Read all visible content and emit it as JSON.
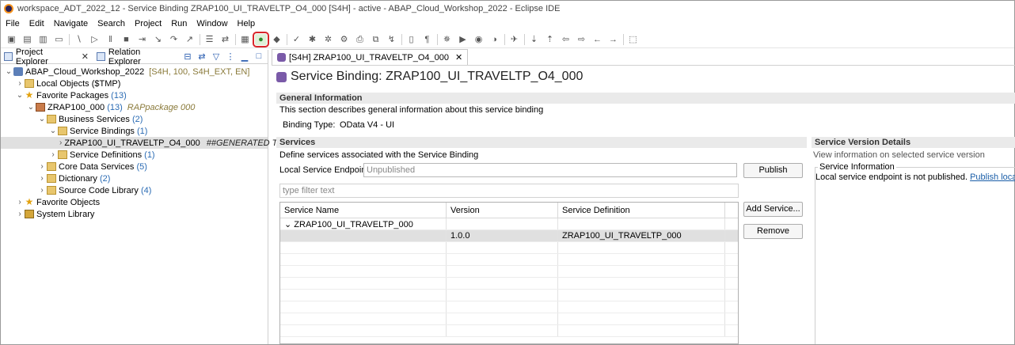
{
  "window": {
    "title": "workspace_ADT_2022_12 - Service Binding ZRAP100_UI_TRAVELTP_O4_000 [S4H]  - active - ABAP_Cloud_Workshop_2022 - Eclipse IDE"
  },
  "menu": [
    "File",
    "Edit",
    "Navigate",
    "Search",
    "Project",
    "Run",
    "Window",
    "Help"
  ],
  "left_panel": {
    "tabs": [
      {
        "label": "Project Explorer"
      },
      {
        "label": "Relation Explorer"
      }
    ],
    "tree": [
      {
        "label": "ABAP_Cloud_Workshop_2022",
        "extra": "[S4H, 100, S4H_EXT, EN]"
      },
      {
        "label": "Local Objects ($TMP)"
      },
      {
        "label": "Favorite Packages",
        "count": "(13)"
      },
      {
        "label": "ZRAP100_000",
        "count": "(13)",
        "extra": "RAPpackage 000"
      },
      {
        "label": "Business Services",
        "count": "(2)"
      },
      {
        "label": "Service Bindings",
        "count": "(1)"
      },
      {
        "label": "ZRAP100_UI_TRAVELTP_O4_000",
        "extra": "##GENERATED Trave"
      },
      {
        "label": "Service Definitions",
        "count": "(1)"
      },
      {
        "label": "Core Data Services",
        "count": "(5)"
      },
      {
        "label": "Dictionary",
        "count": "(2)"
      },
      {
        "label": "Source Code Library",
        "count": "(4)"
      },
      {
        "label": "Favorite Objects"
      },
      {
        "label": "System Library"
      }
    ]
  },
  "editor": {
    "tab_label": "[S4H] ZRAP100_UI_TRAVELTP_O4_000",
    "title": "Service Binding: ZRAP100_UI_TRAVELTP_O4_000",
    "general": {
      "header": "General Information",
      "description": "This section describes general information about this service binding",
      "binding_type_label": "Binding Type:",
      "binding_type_value": "OData V4 - UI"
    },
    "services": {
      "header": "Services",
      "description": "Define services associated with the Service Binding",
      "endpoint_label": "Local Service Endpoint:",
      "endpoint_value": "Unpublished",
      "publish_button": "Publish",
      "filter_placeholder": "type filter text",
      "columns": [
        "Service Name",
        "Version",
        "Service Definition"
      ],
      "group_row": "ZRAP100_UI_TRAVELTP_000",
      "item_row": {
        "version": "1.0.0",
        "definition": "ZRAP100_UI_TRAVELTP_000"
      },
      "add_button": "Add Service...",
      "remove_button": "Remove"
    },
    "version_details": {
      "header": "Service Version Details",
      "description": "View information on selected service version",
      "box_title": "Service Information",
      "status": "Local service endpoint is not published.",
      "link": "Publish local serv"
    }
  }
}
